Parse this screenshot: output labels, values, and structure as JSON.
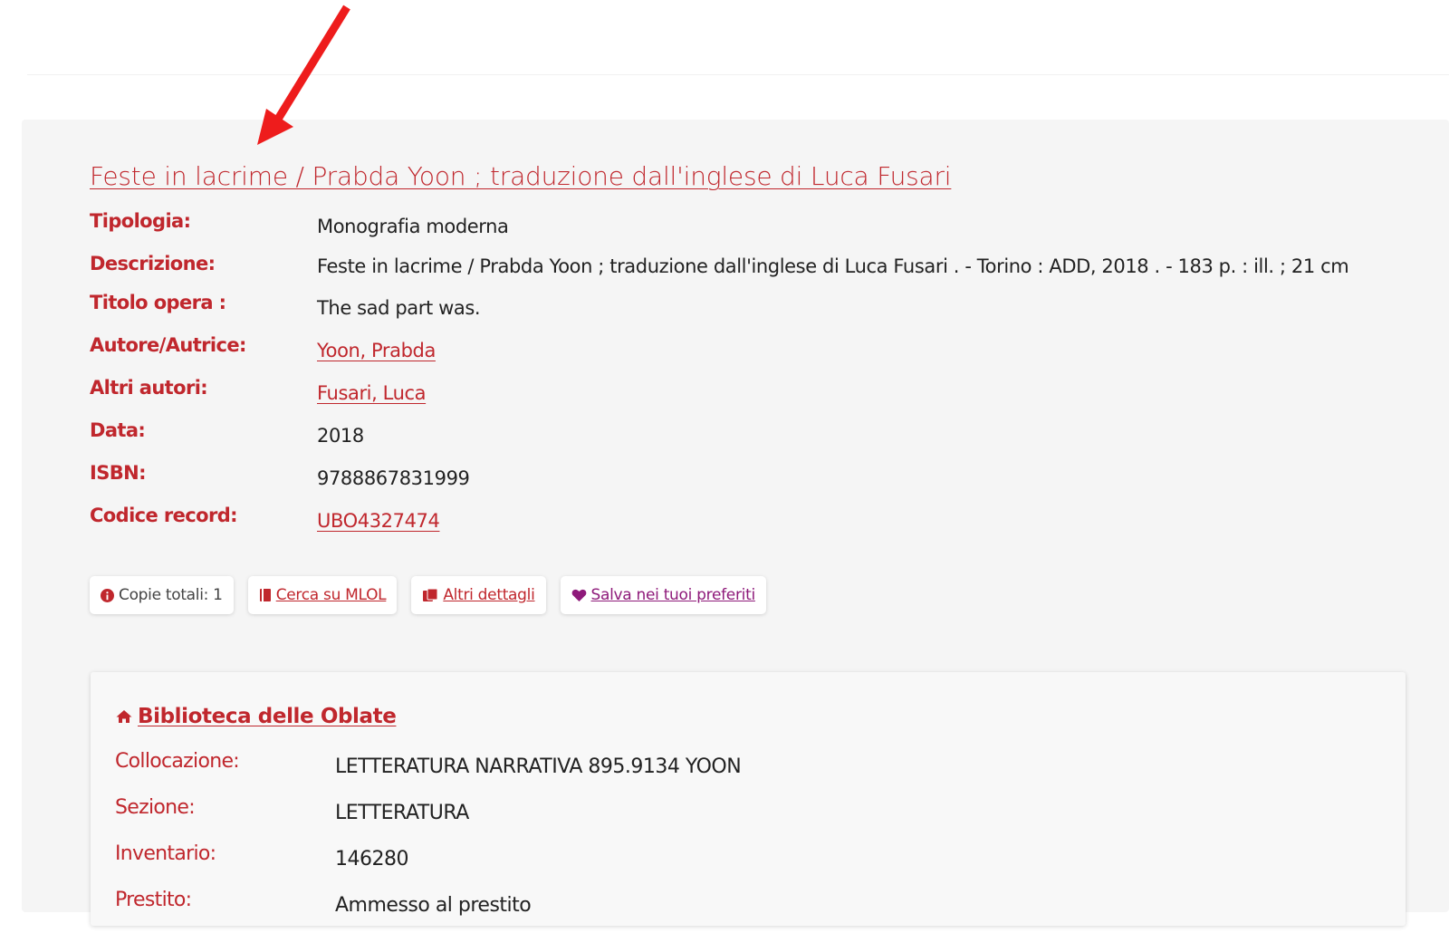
{
  "record": {
    "title": "Feste in lacrime / Prabda Yoon ; traduzione dall'inglese di Luca Fusari",
    "fields": [
      {
        "label": "Tipologia:",
        "value": "Monografia moderna"
      },
      {
        "label": "Descrizione:",
        "value": "Feste in lacrime / Prabda Yoon ; traduzione dall'inglese di Luca Fusari . - Torino : ADD, 2018 . - 183 p. : ill. ; 21 cm"
      },
      {
        "label": "Titolo opera :",
        "value": "The sad part was."
      },
      {
        "label": "Autore/Autrice:",
        "value": "Yoon, Prabda"
      },
      {
        "label": "Altri autori:",
        "value": "Fusari, Luca"
      },
      {
        "label": "Data:",
        "value": "2018"
      },
      {
        "label": "ISBN:",
        "value": "9788867831999"
      },
      {
        "label": "Codice record:",
        "value": "UBO4327474"
      }
    ]
  },
  "actions": {
    "copies_label": "Copie totali: 1",
    "mlol_label": "Cerca su MLOL",
    "details_label": "Altri dettagli",
    "favorite_label": "Salva nei tuoi preferiti"
  },
  "holding": {
    "library_name": "Biblioteca delle Oblate",
    "fields": [
      {
        "label": "Collocazione:",
        "value": "LETTERATURA NARRATIVA 895.9134 YOON"
      },
      {
        "label": "Sezione:",
        "value": "LETTERATURA"
      },
      {
        "label": "Inventario:",
        "value": "146280"
      },
      {
        "label": "Prestito:",
        "value": "Ammesso al prestito"
      }
    ]
  },
  "icons": {
    "info": "info-circle-icon",
    "mlol": "book-icon",
    "details": "books-icon",
    "favorite": "heart-icon",
    "library": "home-icon",
    "annotation": "red-arrow-icon"
  },
  "colors": {
    "accent": "#c0272d",
    "favorite": "#8e1a7a",
    "panel_background": "#f5f5f5",
    "annotation_arrow": "#ee1c1c"
  }
}
